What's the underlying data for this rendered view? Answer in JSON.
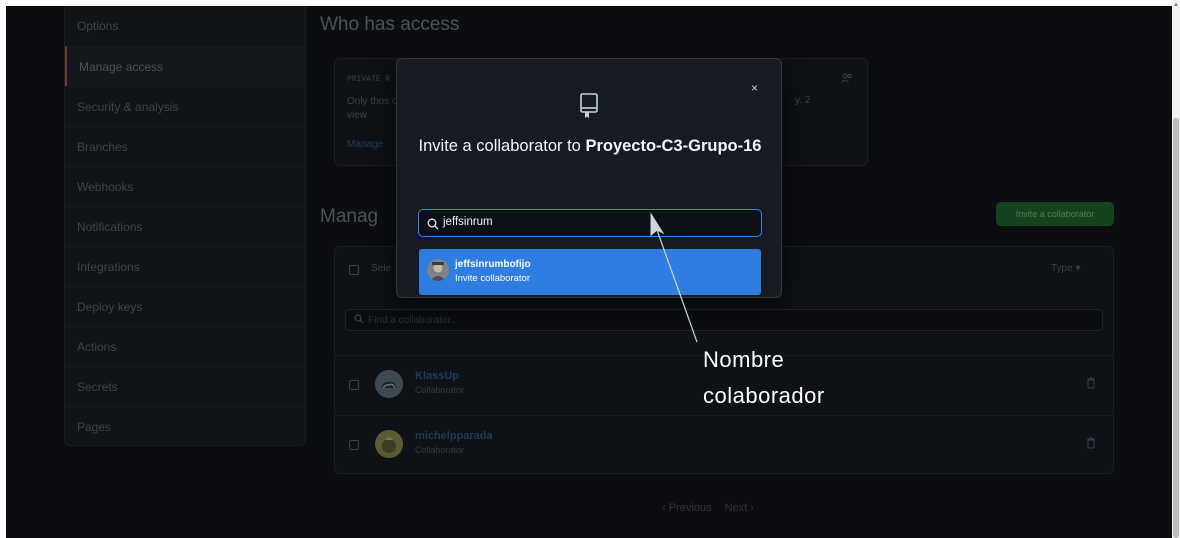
{
  "sidebar": {
    "items": [
      {
        "label": "Options"
      },
      {
        "label": "Manage access"
      },
      {
        "label": "Security & analysis"
      },
      {
        "label": "Branches"
      },
      {
        "label": "Webhooks"
      },
      {
        "label": "Notifications"
      },
      {
        "label": "Integrations"
      },
      {
        "label": "Deploy keys"
      },
      {
        "label": "Actions"
      },
      {
        "label": "Secrets"
      },
      {
        "label": "Pages"
      }
    ],
    "active": "Manage access"
  },
  "access": {
    "title": "Who has access",
    "visibility_label": "PRIVATE R",
    "description": "Only thos can view",
    "description_tail": "y. 2",
    "manage_link": "Manage"
  },
  "collaborators": {
    "heading": "Manag",
    "invite_button": "Invite a collaborator",
    "select_all": "Sele",
    "type_filter": "Type ▾",
    "search_placeholder": "Find a collaborator...",
    "rows": [
      {
        "name": "KlassUp",
        "role": "Collaborator"
      },
      {
        "name": "michelpparada",
        "role": "Collaborator"
      }
    ]
  },
  "pagination": {
    "previous": "‹ Previous",
    "next": "Next ›"
  },
  "modal": {
    "close_label": "×",
    "title_prefix": "Invite a collaborator to ",
    "repo_name": "Proyecto-C3-Grupo-16",
    "search_value": "jeffsinrum",
    "suggestion": {
      "username": "jeffsinrumbofijo",
      "action": "Invite collaborator"
    }
  },
  "annotation": {
    "line1": "Nombre",
    "line2": "colaborador"
  },
  "colors": {
    "background": "#0b0d10",
    "modal": "#161b22",
    "accent_blue": "#2f7de1",
    "invite_green": "#16431f"
  },
  "icons": [
    "repo-icon",
    "close-icon",
    "search-icon",
    "people-icon",
    "trash-icon",
    "arrow-annotation"
  ]
}
